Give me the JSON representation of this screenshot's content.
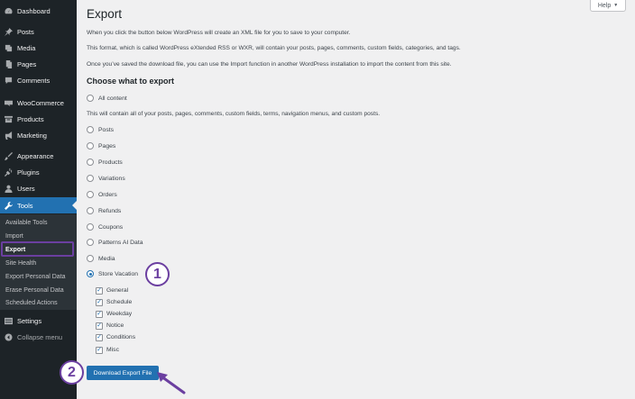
{
  "sidebar": {
    "items": [
      {
        "label": "Dashboard",
        "icon": "dashboard-icon"
      },
      {
        "label": "Posts",
        "icon": "pin-icon"
      },
      {
        "label": "Media",
        "icon": "media-icon"
      },
      {
        "label": "Pages",
        "icon": "pages-icon"
      },
      {
        "label": "Comments",
        "icon": "comment-icon"
      },
      {
        "label": "WooCommerce",
        "icon": "woocommerce-icon"
      },
      {
        "label": "Products",
        "icon": "archive-icon"
      },
      {
        "label": "Marketing",
        "icon": "megaphone-icon"
      },
      {
        "label": "Appearance",
        "icon": "brush-icon"
      },
      {
        "label": "Plugins",
        "icon": "plug-icon"
      },
      {
        "label": "Users",
        "icon": "user-icon"
      },
      {
        "label": "Tools",
        "icon": "wrench-icon"
      },
      {
        "label": "Settings",
        "icon": "settings-icon"
      }
    ],
    "submenu": [
      "Available Tools",
      "Import",
      "Export",
      "Site Health",
      "Export Personal Data",
      "Erase Personal Data",
      "Scheduled Actions"
    ],
    "collapse_label": "Collapse menu"
  },
  "help_label": "Help",
  "page": {
    "title": "Export",
    "paragraphs": [
      "When you click the button below WordPress will create an XML file for you to save to your computer.",
      "This format, which is called WordPress eXtended RSS or WXR, will contain your posts, pages, comments, custom fields, categories, and tags.",
      "Once you’ve saved the download file, you can use the Import function in another WordPress installation to import the content from this site."
    ],
    "section_title": "Choose what to export",
    "all_content_label": "All content",
    "all_content_desc": "This will contain all of your posts, pages, comments, custom fields, terms, navigation menus, and custom posts.",
    "options": [
      "Posts",
      "Pages",
      "Products",
      "Variations",
      "Orders",
      "Refunds",
      "Coupons",
      "Patterns AI Data",
      "Media",
      "Store Vacation"
    ],
    "selected_option": "Store Vacation",
    "suboptions": [
      "General",
      "Schedule",
      "Weekday",
      "Notice",
      "Conditions",
      "Misc"
    ],
    "download_label": "Download Export File"
  },
  "annotations": {
    "step1": "1",
    "step2": "2"
  },
  "colors": {
    "admin_bar": "#1d2327",
    "accent": "#2271b1",
    "annotation": "#6b3fa0",
    "background": "#f0f0f1"
  }
}
